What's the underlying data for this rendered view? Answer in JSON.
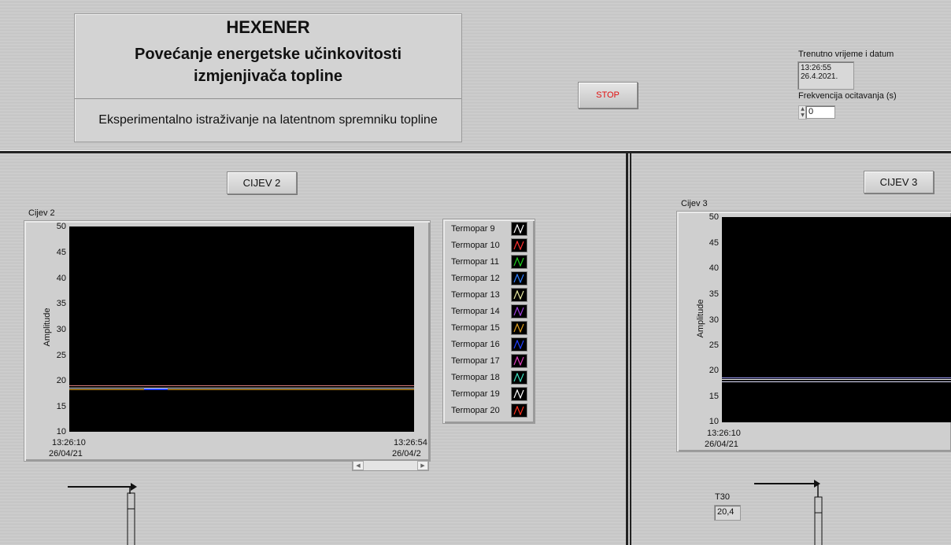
{
  "header": {
    "title": "HEXENER",
    "subtitle_line1": "Povećanje energetske učinkovitosti",
    "subtitle_line2": "izmjenjivača topline",
    "description": "Eksperimentalno istraživanje na latentnom spremniku topline"
  },
  "controls": {
    "stop_label": "STOP",
    "datetime_label": "Trenutno vrijeme i datum",
    "time_value": "13:26:55",
    "date_value": "26.4.2021.",
    "freq_label": "Frekvencija ocitavanja (s)",
    "freq_value": "0"
  },
  "section2": {
    "button_label": "CIJEV 2",
    "graph_label": "Cijev 2",
    "y_axis_label": "Amplitude",
    "y_ticks": [
      "50",
      "45",
      "40",
      "35",
      "30",
      "25",
      "20",
      "15",
      "10"
    ],
    "x_start_time": "13:26:10",
    "x_start_date": "26/04/21",
    "x_end_time": "13:26:54",
    "x_end_date": "26/04/2",
    "legend": [
      {
        "name": "Termopar 9",
        "color": "#ffffff"
      },
      {
        "name": "Termopar 10",
        "color": "#ff3030"
      },
      {
        "name": "Termopar 11",
        "color": "#20d020"
      },
      {
        "name": "Termopar 12",
        "color": "#3080ff"
      },
      {
        "name": "Termopar 13",
        "color": "#e8e8a0"
      },
      {
        "name": "Termopar 14",
        "color": "#a040e0"
      },
      {
        "name": "Termopar 15",
        "color": "#e0a020"
      },
      {
        "name": "Termopar 16",
        "color": "#2040ff"
      },
      {
        "name": "Termopar 17",
        "color": "#e040c0"
      },
      {
        "name": "Termopar 18",
        "color": "#40e0c0"
      },
      {
        "name": "Termopar 19",
        "color": "#ffffff"
      },
      {
        "name": "Termopar 20",
        "color": "#ff3020"
      }
    ]
  },
  "section3": {
    "button_label": "CIJEV 3",
    "graph_label": "Cijev 3",
    "y_axis_label": "Amplitude",
    "y_ticks": [
      "50",
      "45",
      "40",
      "35",
      "30",
      "25",
      "20",
      "15",
      "10"
    ],
    "x_start_time": "13:26:10",
    "x_start_date": "26/04/21",
    "t30_label": "T30",
    "t30_value": "20,4"
  }
}
